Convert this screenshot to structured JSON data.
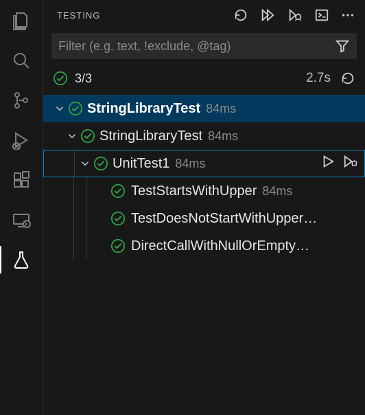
{
  "activity": {
    "items": [
      {
        "name": "files-icon",
        "active": false
      },
      {
        "name": "search-icon",
        "active": false
      },
      {
        "name": "source-control-icon",
        "active": false
      },
      {
        "name": "run-debug-icon",
        "active": false
      },
      {
        "name": "extensions-icon",
        "active": false
      },
      {
        "name": "remote-icon",
        "active": false
      },
      {
        "name": "testing-icon",
        "active": true
      }
    ]
  },
  "panel": {
    "title": "TESTING",
    "header_actions": [
      "refresh",
      "run-all",
      "debug-all",
      "output",
      "more"
    ],
    "filter_placeholder": "Filter (e.g. text, !exclude, @tag)"
  },
  "summary": {
    "passed": 3,
    "total": 3,
    "count_text": "3/3",
    "duration": "2.7s"
  },
  "tree": {
    "root": {
      "name": "StringLibraryTest",
      "status": "pass",
      "duration": "84ms",
      "expanded": true,
      "children": [
        {
          "name": "StringLibraryTest",
          "status": "pass",
          "duration": "84ms",
          "expanded": true,
          "children": [
            {
              "name": "UnitTest1",
              "status": "pass",
              "duration": "84ms",
              "expanded": true,
              "selected": true,
              "children": [
                {
                  "name": "TestStartsWithUpper",
                  "status": "pass",
                  "duration": "84ms"
                },
                {
                  "name": "TestDoesNotStartWithUpper…",
                  "status": "pass"
                },
                {
                  "name": "DirectCallWithNullOrEmpty…",
                  "status": "pass"
                }
              ]
            }
          ]
        }
      ]
    }
  }
}
